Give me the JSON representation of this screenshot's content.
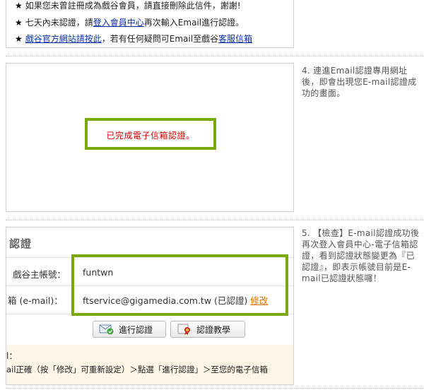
{
  "notes": [
    {
      "text": "如果您未曾註冊成為戲谷會員，請直接刪除此信件，謝謝!"
    },
    {
      "pre": "七天內未認證，請",
      "link": "登入會員中心",
      "post": "再次輸入Email進行認證。"
    },
    {
      "link": "戲谷官方網站請按此",
      "mid": "，若有任何疑問可Email至戲谷",
      "link2": "客服信箱"
    }
  ],
  "steps": {
    "step4": "4. 連進Email認證專用網址後，即會出現您E-mail認證成功的畫面。",
    "step5": "5. 【檢查】E-mail認證成功後再次登入會員中心-電子信箱認證，看到認證狀態變更為『已認證』，即表示帳號目前是E-mail已認證狀態囉！"
  },
  "verify_message": "已完成電子信箱認證。",
  "account_panel": {
    "title": "認證",
    "account_label": "戲谷主帳號：",
    "account_value": "funtwn",
    "email_label": "箱 (e-mail)：",
    "email_value": "ftservice@gigamedia.com.tw",
    "email_status": "(已認證)",
    "edit_label": "修改",
    "verify_button": "進行認證",
    "tutorial_button": "認證教學",
    "info_line1": "l：",
    "info_line2": "ail正確（按「修改」可重新設定）＞點選「進行認證」＞至您的電子信箱"
  },
  "colors": {
    "highlight_green": "#7aa90e",
    "success_red": "#d40000",
    "link_blue": "#0b2fa8",
    "edit_orange": "#e07000"
  }
}
